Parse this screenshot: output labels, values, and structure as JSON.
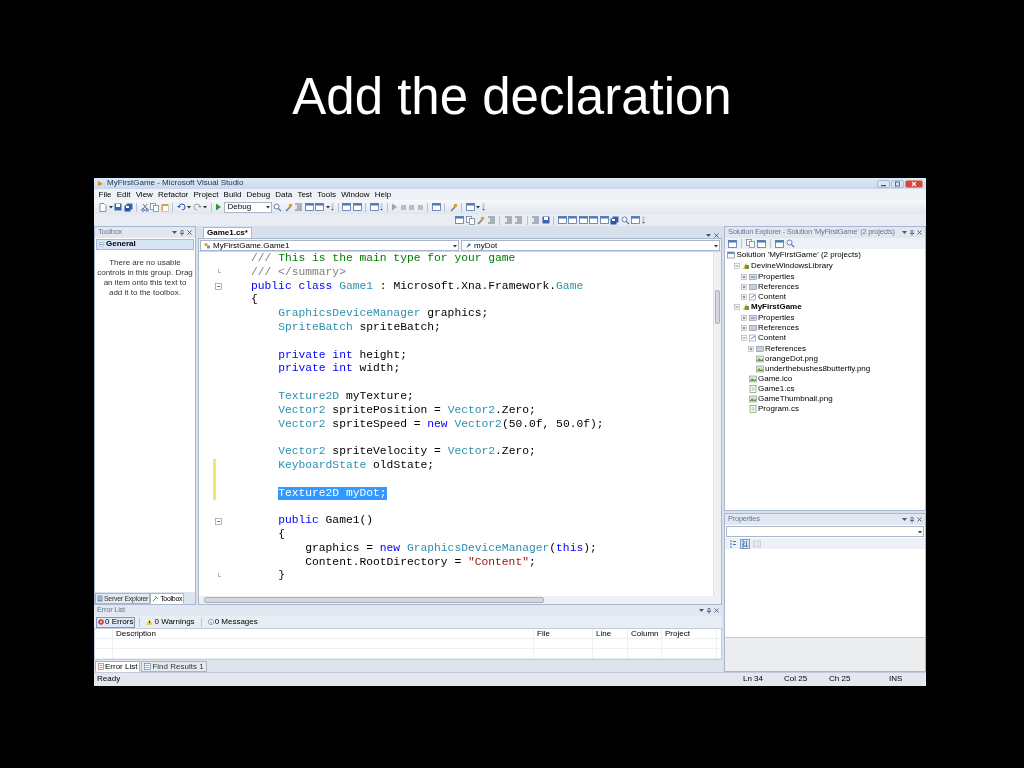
{
  "slide_title": "Add the declaration",
  "window": {
    "title": "MyFirstGame - Microsoft Visual Studio"
  },
  "menu": [
    "File",
    "Edit",
    "View",
    "Refactor",
    "Project",
    "Build",
    "Debug",
    "Data",
    "Test",
    "Tools",
    "Window",
    "Help"
  ],
  "toolbar": {
    "configuration": "Debug"
  },
  "toolbox": {
    "title": "Toolbox",
    "group": {
      "label": "General",
      "expanded": true
    },
    "message": "There are no usable controls in this group. Drag an item onto this text to add it to the toolbox.",
    "tabs": [
      {
        "label": "Server Explorer",
        "kind": "server",
        "selected": false
      },
      {
        "label": "Toolbox",
        "kind": "toolbox",
        "selected": true
      }
    ]
  },
  "editor": {
    "tabs": [
      {
        "label": "Game1.cs*",
        "selected": true
      }
    ],
    "type_dropdown": "MyFirstGame.Game1",
    "member_dropdown": "myDot",
    "lines": [
      {
        "kind": "code",
        "tokens": [
          {
            "kind": "doc",
            "text": "/// "
          },
          {
            "kind": "comment",
            "text": "This is the main type for your game"
          }
        ],
        "selected": false,
        "changed": false
      },
      {
        "kind": "fold_end",
        "tokens": [
          {
            "kind": "doc",
            "text": "/// </summary>"
          }
        ],
        "selected": false,
        "changed": false
      },
      {
        "kind": "fold_start",
        "tokens": [
          {
            "kind": "keyword",
            "text": "public class "
          },
          {
            "kind": "type",
            "text": "Game1"
          },
          {
            "kind": "plain",
            "text": " : Microsoft.Xna.Framework."
          },
          {
            "kind": "type",
            "text": "Game"
          }
        ],
        "selected": false,
        "changed": false
      },
      {
        "kind": "code",
        "tokens": [
          {
            "kind": "plain",
            "text": "{"
          }
        ],
        "selected": false,
        "changed": false
      },
      {
        "kind": "code",
        "tokens": [
          {
            "kind": "type",
            "text": "    GraphicsDeviceManager"
          },
          {
            "kind": "plain",
            "text": " graphics;"
          }
        ],
        "selected": false,
        "changed": false
      },
      {
        "kind": "code",
        "tokens": [
          {
            "kind": "type",
            "text": "    SpriteBatch"
          },
          {
            "kind": "plain",
            "text": " spriteBatch;"
          }
        ],
        "selected": false,
        "changed": false
      },
      {
        "kind": "blank",
        "selected": false,
        "changed": false
      },
      {
        "kind": "code",
        "tokens": [
          {
            "kind": "keyword",
            "text": "    private int"
          },
          {
            "kind": "plain",
            "text": " height;"
          }
        ],
        "selected": false,
        "changed": false
      },
      {
        "kind": "code",
        "tokens": [
          {
            "kind": "keyword",
            "text": "    private int"
          },
          {
            "kind": "plain",
            "text": " width;"
          }
        ],
        "selected": false,
        "changed": false
      },
      {
        "kind": "blank",
        "selected": false,
        "changed": false
      },
      {
        "kind": "code",
        "tokens": [
          {
            "kind": "type",
            "text": "    Texture2D"
          },
          {
            "kind": "plain",
            "text": " myTexture;"
          }
        ],
        "selected": false,
        "changed": false
      },
      {
        "kind": "code",
        "tokens": [
          {
            "kind": "type",
            "text": "    Vector2"
          },
          {
            "kind": "plain",
            "text": " spritePosition = "
          },
          {
            "kind": "type",
            "text": "Vector2"
          },
          {
            "kind": "plain",
            "text": ".Zero;"
          }
        ],
        "selected": false,
        "changed": false
      },
      {
        "kind": "code",
        "tokens": [
          {
            "kind": "type",
            "text": "    Vector2"
          },
          {
            "kind": "plain",
            "text": " spriteSpeed = "
          },
          {
            "kind": "keyword",
            "text": "new "
          },
          {
            "kind": "type",
            "text": "Vector2"
          },
          {
            "kind": "plain",
            "text": "(50.0f, 50.0f);"
          }
        ],
        "selected": false,
        "changed": false
      },
      {
        "kind": "blank",
        "selected": false,
        "changed": false
      },
      {
        "kind": "code",
        "tokens": [
          {
            "kind": "type",
            "text": "    Vector2"
          },
          {
            "kind": "plain",
            "text": " spriteVelocity = "
          },
          {
            "kind": "type",
            "text": "Vector2"
          },
          {
            "kind": "plain",
            "text": ".Zero;"
          }
        ],
        "selected": false,
        "changed": false
      },
      {
        "kind": "code",
        "tokens": [
          {
            "kind": "type",
            "text": "    KeyboardState"
          },
          {
            "kind": "plain",
            "text": " oldState;"
          }
        ],
        "selected": false,
        "changed": true
      },
      {
        "kind": "blank",
        "selected": false,
        "changed": true
      },
      {
        "kind": "code",
        "tokens": [
          {
            "kind": "type",
            "text": "    Texture2D"
          },
          {
            "kind": "plain",
            "text": " myDot;"
          }
        ],
        "selected": true,
        "changed": true
      },
      {
        "kind": "blank",
        "selected": false,
        "changed": false
      },
      {
        "kind": "fold_start",
        "tokens": [
          {
            "kind": "keyword",
            "text": "    public"
          },
          {
            "kind": "plain",
            "text": " Game1()"
          }
        ],
        "selected": false,
        "changed": false
      },
      {
        "kind": "code",
        "tokens": [
          {
            "kind": "plain",
            "text": "    {"
          }
        ],
        "selected": false,
        "changed": false
      },
      {
        "kind": "code",
        "tokens": [
          {
            "kind": "plain",
            "text": "        graphics = "
          },
          {
            "kind": "keyword",
            "text": "new "
          },
          {
            "kind": "type",
            "text": "GraphicsDeviceManager"
          },
          {
            "kind": "plain",
            "text": "("
          },
          {
            "kind": "keyword",
            "text": "this"
          },
          {
            "kind": "plain",
            "text": ");"
          }
        ],
        "selected": false,
        "changed": false
      },
      {
        "kind": "code",
        "tokens": [
          {
            "kind": "plain",
            "text": "        Content.RootDirectory = "
          },
          {
            "kind": "string",
            "text": "\"Content\""
          },
          {
            "kind": "plain",
            "text": ";"
          }
        ],
        "selected": false,
        "changed": false
      },
      {
        "kind": "fold_end",
        "tokens": [
          {
            "kind": "plain",
            "text": "    }"
          }
        ],
        "selected": false,
        "changed": false
      }
    ]
  },
  "solution_explorer": {
    "title": "Solution Explorer - Solution 'MyFirstGame' (2 projects)",
    "tree": [
      {
        "label": "Solution 'MyFirstGame' (2 projects)",
        "kind": "solution",
        "children": [
          {
            "label": "DevineWindowsLibrary",
            "kind": "project",
            "expanded": true,
            "startup": false,
            "children": [
              {
                "label": "Properties",
                "kind": "properties",
                "expanded": false
              },
              {
                "label": "References",
                "kind": "folder",
                "expanded": false
              },
              {
                "label": "Content",
                "kind": "content",
                "expanded": false
              }
            ]
          },
          {
            "label": "MyFirstGame",
            "kind": "project",
            "expanded": true,
            "startup": true,
            "children": [
              {
                "label": "Properties",
                "kind": "properties",
                "expanded": false
              },
              {
                "label": "References",
                "kind": "folder",
                "expanded": false
              },
              {
                "label": "Content",
                "kind": "content",
                "expanded": true,
                "children": [
                  {
                    "label": "References",
                    "kind": "folder",
                    "expanded": false
                  },
                  {
                    "label": "orangeDot.png",
                    "kind": "image"
                  },
                  {
                    "label": "underthebushes8butterfly.png",
                    "kind": "image"
                  }
                ]
              },
              {
                "label": "Game.ico",
                "kind": "image"
              },
              {
                "label": "Game1.cs",
                "kind": "code"
              },
              {
                "label": "GameThumbnail.png",
                "kind": "image"
              },
              {
                "label": "Program.cs",
                "kind": "code"
              }
            ]
          }
        ]
      }
    ]
  },
  "properties": {
    "title": "Properties",
    "buttons": [
      {
        "kind": "categorized",
        "selected": false
      },
      {
        "kind": "alphabetical",
        "selected": true
      },
      {
        "kind": "pages",
        "selected": false
      }
    ]
  },
  "error_list": {
    "title": "Error List",
    "filters": [
      {
        "label": "0 Errors",
        "kind": "error",
        "selected": true
      },
      {
        "label": "0 Warnings",
        "kind": "warning",
        "selected": false
      },
      {
        "label": "0 Messages",
        "kind": "message",
        "selected": false
      }
    ],
    "columns": [
      "Description",
      "File",
      "Line",
      "Column",
      "Project"
    ],
    "tabs": [
      {
        "label": "Error List",
        "kind": "errors",
        "selected": true
      },
      {
        "label": "Find Results 1",
        "kind": "find",
        "selected": false
      }
    ]
  },
  "status_bar": {
    "message": "Ready",
    "line": "Ln 34",
    "column": "Col 25",
    "char": "Ch 25",
    "mode": "INS"
  }
}
